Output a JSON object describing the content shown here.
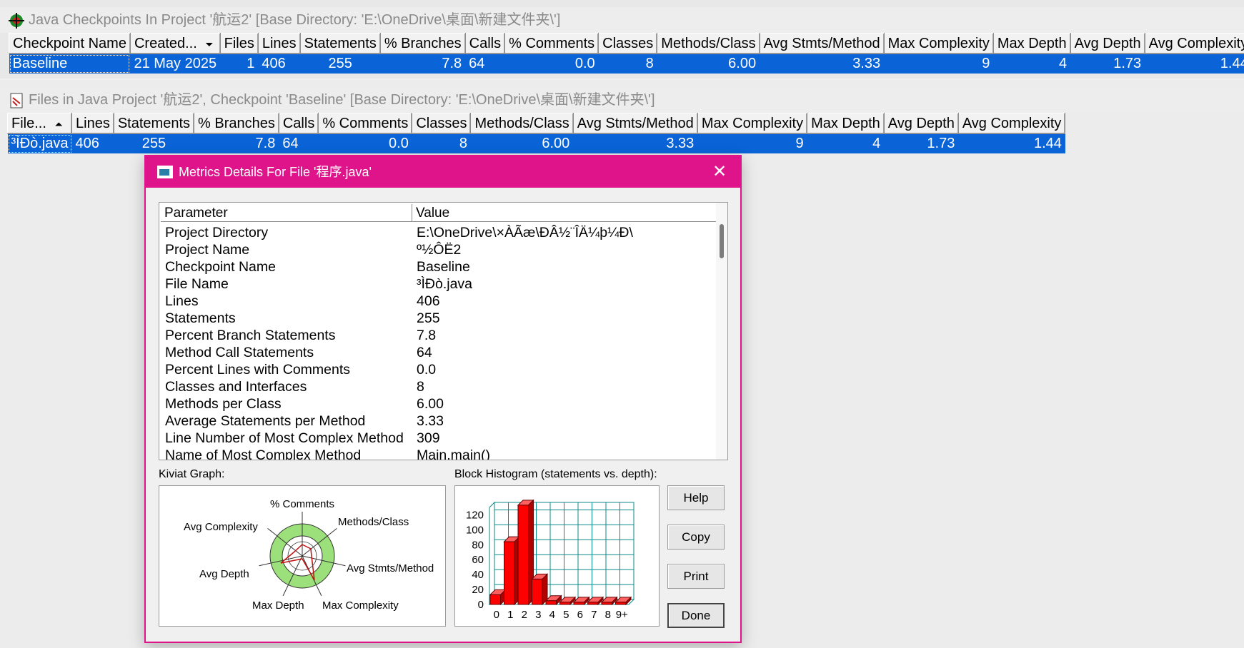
{
  "checkpoints_window": {
    "title": "Java Checkpoints In Project '航运2'  [Base Directory: 'E:\\OneDrive\\桌面\\新建文件夹\\']",
    "columns": [
      "Checkpoint Name",
      "Created...",
      "Files",
      "Lines",
      "Statements",
      "% Branches",
      "Calls",
      "% Comments",
      "Classes",
      "Methods/Class",
      "Avg Stmts/Method",
      "Max Complexity",
      "Max Depth",
      "Avg Depth",
      "Avg Complexity"
    ],
    "sort_arrow": "⏷",
    "row": [
      "Baseline",
      "21 May 2025",
      "1",
      "406",
      "255",
      "7.8",
      "64",
      "0.0",
      "8",
      "6.00",
      "3.33",
      "9",
      "4",
      "1.73",
      "1.44"
    ]
  },
  "files_window": {
    "title": "Files in Java Project '航运2', Checkpoint 'Baseline'  [Base Directory: 'E:\\OneDrive\\桌面\\新建文件夹\\']",
    "columns": [
      "File...",
      "Lines",
      "Statements",
      "% Branches",
      "Calls",
      "% Comments",
      "Classes",
      "Methods/Class",
      "Avg Stmts/Method",
      "Max Complexity",
      "Max Depth",
      "Avg Depth",
      "Avg Complexity"
    ],
    "sort_arrow": "⏶",
    "row": [
      "³ÌÐò.java",
      "406",
      "255",
      "7.8",
      "64",
      "0.0",
      "8",
      "6.00",
      "3.33",
      "9",
      "4",
      "1.73",
      "1.44"
    ]
  },
  "dialog": {
    "title": "Metrics Details For File '程序.java'",
    "close_glyph": "✕",
    "headers": {
      "parameter": "Parameter",
      "value": "Value"
    },
    "rows": [
      {
        "p": "Project Directory",
        "v": "E:\\OneDrive\\×ÀÃæ\\ÐÂ½¨ÎÄ¼þ¼Ð\\"
      },
      {
        "p": "Project Name",
        "v": "º½ÔË2"
      },
      {
        "p": "Checkpoint Name",
        "v": "Baseline"
      },
      {
        "p": "File Name",
        "v": "³ÌÐò.java"
      },
      {
        "p": "Lines",
        "v": "406"
      },
      {
        "p": "Statements",
        "v": "255"
      },
      {
        "p": "Percent Branch Statements",
        "v": "7.8"
      },
      {
        "p": "Method Call Statements",
        "v": "64"
      },
      {
        "p": "Percent Lines with Comments",
        "v": "0.0"
      },
      {
        "p": "Classes and Interfaces",
        "v": "8"
      },
      {
        "p": "Methods per Class",
        "v": "6.00"
      },
      {
        "p": "Average Statements per Method",
        "v": "3.33"
      },
      {
        "p": "Line Number of Most Complex Method",
        "v": "309"
      },
      {
        "p": "Name of Most Complex Method",
        "v": "Main.main()"
      }
    ],
    "kiviat_label": "Kiviat Graph:",
    "histogram_label": "Block Histogram (statements vs. depth):",
    "kiviat_axes": [
      "% Comments",
      "Methods/Class",
      "Avg Stmts/Method",
      "Max Complexity",
      "Max Depth",
      "Avg Depth",
      "Avg Complexity"
    ],
    "buttons": {
      "help": "Help",
      "copy": "Copy",
      "print": "Print",
      "done": "Done"
    }
  },
  "chart_data": {
    "type": "bar",
    "categories": [
      "0",
      "1",
      "2",
      "3",
      "4",
      "5",
      "6",
      "7",
      "8",
      "9+"
    ],
    "values": [
      13,
      84,
      133,
      34,
      5,
      3,
      3,
      3,
      3,
      3
    ],
    "ylim": [
      0,
      130
    ],
    "yticks": [
      "120",
      "100",
      "80",
      "60",
      "40",
      "20",
      "0"
    ],
    "bar_color": "#ff0000",
    "grid_color": "#0a8a8a"
  },
  "colors": {
    "selection": "#0a64d8",
    "dialog_accent": "#e0148a"
  }
}
